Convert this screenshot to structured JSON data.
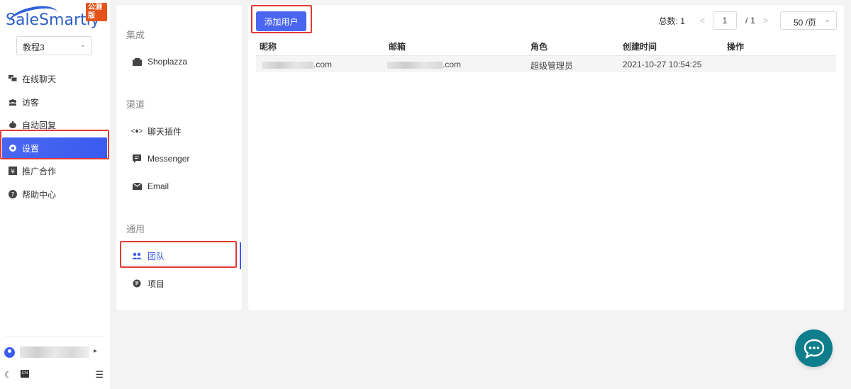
{
  "brand": {
    "name": "SaleSmartly",
    "badge": "公测版"
  },
  "project_select": {
    "value": "教程3"
  },
  "nav": {
    "items": [
      {
        "label": "在线聊天",
        "icon": "chat-icon"
      },
      {
        "label": "访客",
        "icon": "visitors-icon"
      },
      {
        "label": "自动回复",
        "icon": "robot-icon"
      },
      {
        "label": "设置",
        "icon": "settings-icon",
        "active": true
      },
      {
        "label": "推广合作",
        "icon": "yen-icon"
      },
      {
        "label": "帮助中心",
        "icon": "help-icon"
      }
    ],
    "lang_label": "CN"
  },
  "settings_nav": {
    "groups": [
      {
        "title": "集成",
        "items": [
          {
            "label": "Shoplazza",
            "icon": "shop-icon"
          }
        ]
      },
      {
        "title": "渠道",
        "items": [
          {
            "label": "聊天插件",
            "icon": "code-icon"
          },
          {
            "label": "Messenger",
            "icon": "messenger-icon"
          },
          {
            "label": "Email",
            "icon": "email-icon"
          }
        ]
      },
      {
        "title": "通用",
        "items": [
          {
            "label": "团队",
            "icon": "team-icon",
            "active": true
          },
          {
            "label": "项目",
            "icon": "globe-icon"
          }
        ]
      }
    ]
  },
  "main": {
    "add_button": "添加用户",
    "pager": {
      "total_label": "总数:",
      "total": "1",
      "current_page": "1",
      "page_sep": "/",
      "page_count": "1",
      "page_size": "50 /页"
    },
    "table": {
      "columns": [
        "昵称",
        "邮箱",
        "角色",
        "创建时间",
        "操作"
      ],
      "rows": [
        {
          "nickname_suffix": ".com",
          "email_suffix": ".com",
          "role": "超级管理员",
          "created": "2021-10-27 10:54:25",
          "action": ""
        }
      ]
    }
  },
  "colors": {
    "accent": "#4a66f0",
    "highlight": "#e53935",
    "fab": "#0e7e8c"
  }
}
